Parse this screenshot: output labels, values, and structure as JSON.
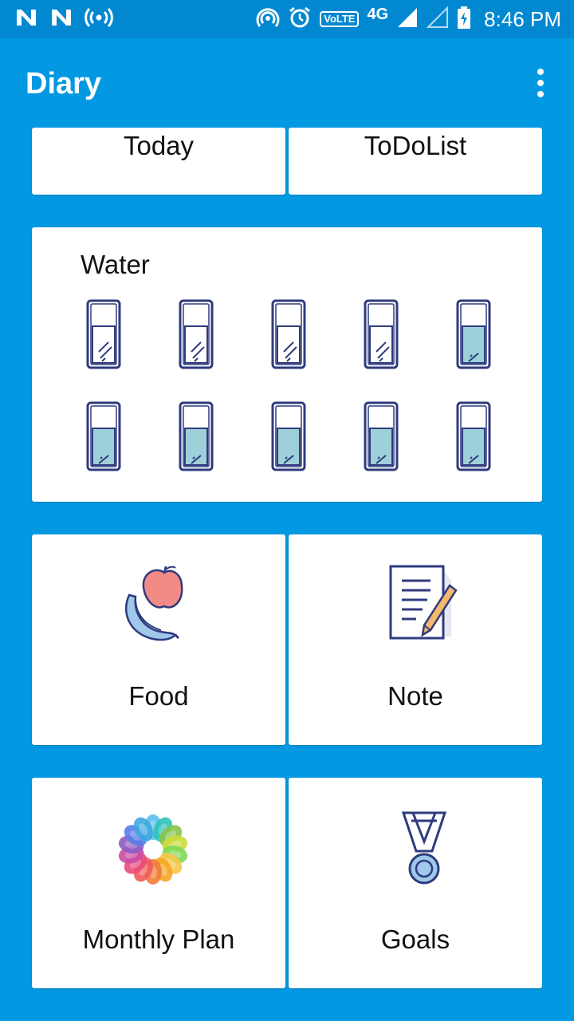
{
  "status_bar": {
    "time": "8:46 PM",
    "network": "4G",
    "volte": "VoLTE",
    "icons": [
      "n-icon",
      "n-icon",
      "broadcast-icon",
      "hotspot-icon",
      "alarm-icon",
      "signal-icon",
      "battery-icon"
    ]
  },
  "app": {
    "title": "Diary",
    "menu_icon": "overflow-menu-icon"
  },
  "tiles": {
    "today": "Today",
    "todo": "ToDoList",
    "water": {
      "title": "Water",
      "glasses_total": 10,
      "glasses_full": 6
    },
    "food": {
      "label": "Food",
      "icon": "fruit-icon"
    },
    "note": {
      "label": "Note",
      "icon": "note-pencil-icon"
    },
    "monthly": {
      "label": "Monthly Plan",
      "icon": "color-wheel-icon"
    },
    "goals": {
      "label": "Goals",
      "icon": "medal-icon"
    }
  },
  "colors": {
    "background": "#0399E2",
    "status_bar": "#0288D1",
    "water_fill": "#9ED0DA",
    "apple": "#F28B85",
    "banana": "#9FC8EA",
    "outline": "#2F3B7E"
  }
}
